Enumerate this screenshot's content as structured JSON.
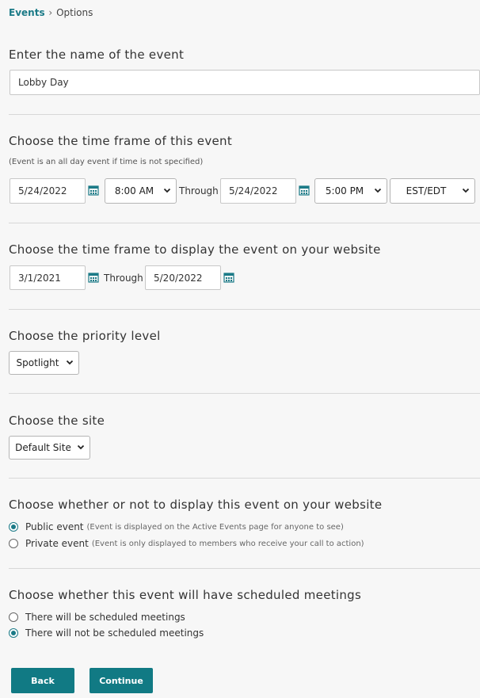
{
  "breadcrumb": {
    "link": "Events",
    "separator": "›",
    "current": "Options"
  },
  "name_section": {
    "heading": "Enter the name of the event",
    "value": "Lobby Day"
  },
  "timeframe_section": {
    "heading": "Choose the time frame of this event",
    "note": "(Event is an all day event if time is not specified)",
    "start_date": "5/24/2022",
    "start_time": "8:00 AM",
    "through_label": "Through",
    "end_date": "5/24/2022",
    "end_time": "5:00 PM",
    "timezone": "EST/EDT"
  },
  "display_section": {
    "heading": "Choose the time frame to display the event on your website",
    "start_date": "3/1/2021",
    "through_label": "Through",
    "end_date": "5/20/2022"
  },
  "priority_section": {
    "heading": "Choose the priority level",
    "value": "Spotlight"
  },
  "site_section": {
    "heading": "Choose the site",
    "value": "Default Site"
  },
  "visibility_section": {
    "heading": "Choose whether or not to display this event on your website",
    "options": [
      {
        "label": "Public event",
        "hint": "(Event is displayed on the Active Events page for anyone to see)",
        "selected": true
      },
      {
        "label": "Private event",
        "hint": "(Event is only displayed to members who receive your call to action)",
        "selected": false
      }
    ]
  },
  "meetings_section": {
    "heading": "Choose whether this event will have scheduled meetings",
    "options": [
      {
        "label": "There will be scheduled meetings",
        "selected": false
      },
      {
        "label": "There will not be scheduled meetings",
        "selected": true
      }
    ]
  },
  "buttons": {
    "back": "Back",
    "continue": "Continue"
  },
  "colors": {
    "accent": "#117a84",
    "link": "#1b7a87"
  }
}
